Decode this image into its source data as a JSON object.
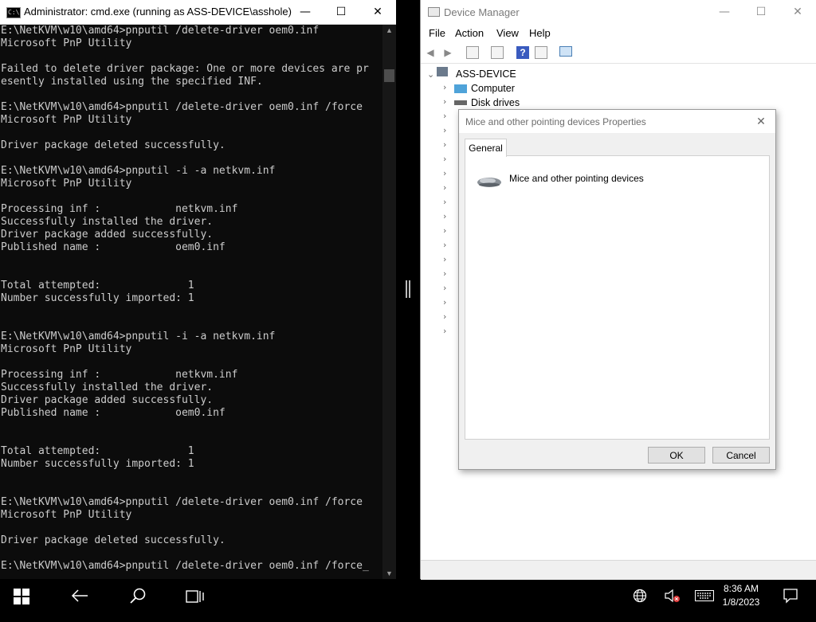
{
  "cmd": {
    "title": "Administrator: cmd.exe (running as ASS-DEVICE\\asshole)",
    "icon": "C:\\",
    "output": "E:\\NetKVM\\w10\\amd64>pnputil /delete-driver oem0.inf\nMicrosoft PnP Utility\n\nFailed to delete driver package: One or more devices are pr\nesently installed using the specified INF.\n\nE:\\NetKVM\\w10\\amd64>pnputil /delete-driver oem0.inf /force\nMicrosoft PnP Utility\n\nDriver package deleted successfully.\n\nE:\\NetKVM\\w10\\amd64>pnputil -i -a netkvm.inf\nMicrosoft PnP Utility\n\nProcessing inf :            netkvm.inf\nSuccessfully installed the driver.\nDriver package added successfully.\nPublished name :            oem0.inf\n\n\nTotal attempted:              1\nNumber successfully imported: 1\n\n\nE:\\NetKVM\\w10\\amd64>pnputil -i -a netkvm.inf\nMicrosoft PnP Utility\n\nProcessing inf :            netkvm.inf\nSuccessfully installed the driver.\nDriver package added successfully.\nPublished name :            oem0.inf\n\n\nTotal attempted:              1\nNumber successfully imported: 1\n\n\nE:\\NetKVM\\w10\\amd64>pnputil /delete-driver oem0.inf /force\nMicrosoft PnP Utility\n\nDriver package deleted successfully.\n\nE:\\NetKVM\\w10\\amd64>pnputil /delete-driver oem0.inf /force_",
    "colors": {
      "background": "#0c0c0c",
      "text": "#cccccc"
    }
  },
  "device_manager": {
    "title": "Device Manager",
    "menu": [
      "File",
      "Action",
      "View",
      "Help"
    ],
    "toolbar_icons": [
      "back-arrow-icon",
      "forward-arrow-icon",
      "properties-icon",
      "details-icon",
      "help-icon",
      "view-icon",
      "scan-hardware-icon"
    ],
    "tree": {
      "root": "ASS-DEVICE",
      "items": [
        "Computer",
        "Disk drives"
      ]
    }
  },
  "dialog": {
    "title": "Mice and other pointing devices Properties",
    "tab": "General",
    "device_label": "Mice and other pointing devices",
    "ok": "OK",
    "cancel": "Cancel"
  },
  "taskbar": {
    "time": "8:36 AM",
    "date": "1/8/2023",
    "icons": [
      "windows-start-icon",
      "back-arrow-icon",
      "search-icon",
      "task-view-icon",
      "network-globe-icon",
      "volume-muted-icon",
      "keyboard-icon",
      "notifications-icon"
    ]
  }
}
